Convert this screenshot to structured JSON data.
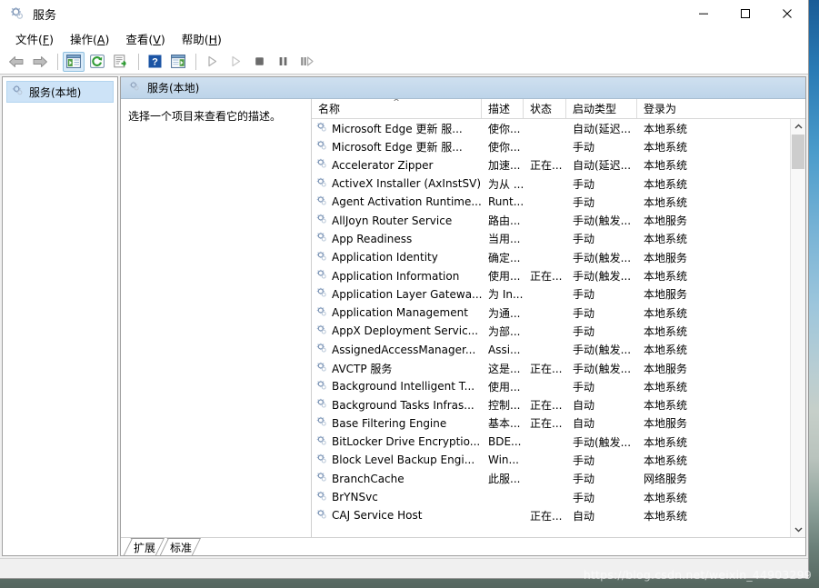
{
  "window": {
    "title": "服务",
    "title_icon": "services-gear-icon",
    "controls": {
      "minimize": "最小化",
      "maximize": "最大化",
      "close": "关闭"
    }
  },
  "menubar": [
    {
      "name": "file",
      "label": "文件",
      "accel": "F"
    },
    {
      "name": "action",
      "label": "操作",
      "accel": "A"
    },
    {
      "name": "view",
      "label": "查看",
      "accel": "V"
    },
    {
      "name": "help",
      "label": "帮助",
      "accel": "H"
    }
  ],
  "toolbar": [
    {
      "name": "back-button",
      "icon": "arrow-left-icon",
      "active": false
    },
    {
      "name": "forward-button",
      "icon": "arrow-right-icon",
      "active": false
    },
    {
      "name": "separator-1",
      "icon": "separator",
      "active": false
    },
    {
      "name": "show-tree-button",
      "icon": "tree-pane-icon",
      "active": true
    },
    {
      "name": "refresh-button",
      "icon": "refresh-icon",
      "active": false
    },
    {
      "name": "export-list-button",
      "icon": "export-list-icon",
      "active": false
    },
    {
      "name": "separator-2",
      "icon": "separator",
      "active": false
    },
    {
      "name": "help-button",
      "icon": "help-question-icon",
      "active": false
    },
    {
      "name": "properties-button",
      "icon": "properties-icon",
      "active": false
    },
    {
      "name": "separator-3",
      "icon": "separator",
      "active": false
    },
    {
      "name": "start-button",
      "icon": "play-icon",
      "active": false
    },
    {
      "name": "resume-button",
      "icon": "play-outline-icon",
      "active": false
    },
    {
      "name": "stop-button",
      "icon": "stop-icon",
      "active": false
    },
    {
      "name": "pause-button",
      "icon": "pause-icon",
      "active": false
    },
    {
      "name": "restart-button",
      "icon": "restart-icon",
      "active": false
    }
  ],
  "tree": {
    "items": [
      {
        "name": "services-local",
        "label": "服务(本地)",
        "icon": "services-gear-icon",
        "selected": true
      }
    ]
  },
  "pane": {
    "header_title": "服务(本地)",
    "header_icon": "services-gear-icon",
    "description_placeholder": "选择一个项目来查看它的描述。"
  },
  "list": {
    "columns": [
      {
        "name": "name",
        "label": "名称",
        "width": 187,
        "sorted": "asc"
      },
      {
        "name": "description",
        "label": "描述",
        "width": 46,
        "sorted": ""
      },
      {
        "name": "status",
        "label": "状态",
        "width": 47,
        "sorted": ""
      },
      {
        "name": "startup_type",
        "label": "启动类型",
        "width": 78,
        "sorted": ""
      },
      {
        "name": "log_on_as",
        "label": "登录为",
        "width": 59,
        "sorted": ""
      }
    ],
    "sort_ascending_glyph": "^",
    "rows": [
      {
        "name": "Microsoft Edge 更新 服...",
        "description": "使你...",
        "status": "",
        "startup_type": "自动(延迟...",
        "log_on_as": "本地系统"
      },
      {
        "name": "Microsoft Edge 更新 服...",
        "description": "使你...",
        "status": "",
        "startup_type": "手动",
        "log_on_as": "本地系统"
      },
      {
        "name": "Accelerator  Zipper",
        "description": "加速...",
        "status": "正在...",
        "startup_type": "自动(延迟...",
        "log_on_as": "本地系统"
      },
      {
        "name": "ActiveX Installer (AxInstSV)",
        "description": "为从 ...",
        "status": "",
        "startup_type": "手动",
        "log_on_as": "本地系统"
      },
      {
        "name": "Agent Activation Runtime...",
        "description": "Runt...",
        "status": "",
        "startup_type": "手动",
        "log_on_as": "本地系统"
      },
      {
        "name": "AllJoyn Router Service",
        "description": "路由...",
        "status": "",
        "startup_type": "手动(触发...",
        "log_on_as": "本地服务"
      },
      {
        "name": "App Readiness",
        "description": "当用...",
        "status": "",
        "startup_type": "手动",
        "log_on_as": "本地系统"
      },
      {
        "name": "Application Identity",
        "description": "确定...",
        "status": "",
        "startup_type": "手动(触发...",
        "log_on_as": "本地服务"
      },
      {
        "name": "Application Information",
        "description": "使用...",
        "status": "正在...",
        "startup_type": "手动(触发...",
        "log_on_as": "本地系统"
      },
      {
        "name": "Application Layer Gatewa...",
        "description": "为 In...",
        "status": "",
        "startup_type": "手动",
        "log_on_as": "本地服务"
      },
      {
        "name": "Application Management",
        "description": "为通...",
        "status": "",
        "startup_type": "手动",
        "log_on_as": "本地系统"
      },
      {
        "name": "AppX Deployment Servic...",
        "description": "为部...",
        "status": "",
        "startup_type": "手动",
        "log_on_as": "本地系统"
      },
      {
        "name": "AssignedAccessManager...",
        "description": "Assi...",
        "status": "",
        "startup_type": "手动(触发...",
        "log_on_as": "本地系统"
      },
      {
        "name": "AVCTP 服务",
        "description": "这是...",
        "status": "正在...",
        "startup_type": "手动(触发...",
        "log_on_as": "本地服务"
      },
      {
        "name": "Background Intelligent T...",
        "description": "使用...",
        "status": "",
        "startup_type": "手动",
        "log_on_as": "本地系统"
      },
      {
        "name": "Background Tasks Infras...",
        "description": "控制...",
        "status": "正在...",
        "startup_type": "自动",
        "log_on_as": "本地系统"
      },
      {
        "name": "Base Filtering Engine",
        "description": "基本...",
        "status": "正在...",
        "startup_type": "自动",
        "log_on_as": "本地服务"
      },
      {
        "name": "BitLocker Drive Encryptio...",
        "description": "BDE...",
        "status": "",
        "startup_type": "手动(触发...",
        "log_on_as": "本地系统"
      },
      {
        "name": "Block Level Backup Engi...",
        "description": "Win...",
        "status": "",
        "startup_type": "手动",
        "log_on_as": "本地系统"
      },
      {
        "name": "BranchCache",
        "description": "此服...",
        "status": "",
        "startup_type": "手动",
        "log_on_as": "网络服务"
      },
      {
        "name": "BrYNSvc",
        "description": "",
        "status": "",
        "startup_type": "手动",
        "log_on_as": "本地系统"
      },
      {
        "name": "CAJ Service Host",
        "description": "",
        "status": "正在...",
        "startup_type": "自动",
        "log_on_as": "本地系统"
      }
    ]
  },
  "scrollbar": {
    "up_arrow": "scroll-up-icon",
    "down_arrow": "scroll-down-icon",
    "thumb": "scroll-thumb"
  },
  "tabs": [
    {
      "name": "tab-extended",
      "label": "扩展",
      "selected": false
    },
    {
      "name": "tab-standard",
      "label": "标准",
      "selected": true
    }
  ],
  "watermark": "https://blog.csdn.net/weixin_44903299",
  "colors": {
    "pane_header": "#c3d7ea",
    "selection": "#cde3f7",
    "toolbar_active": "#d8eaf8",
    "window_border": "#9a9a9a"
  }
}
